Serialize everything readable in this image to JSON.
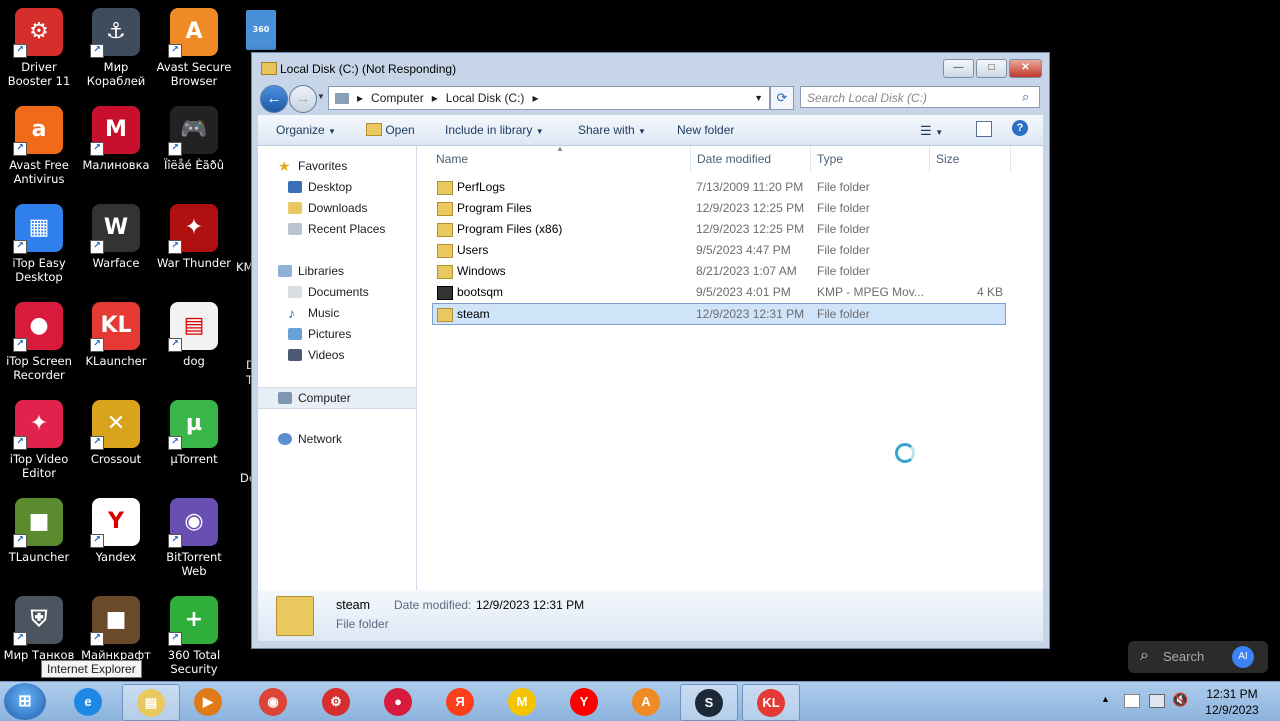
{
  "desktop": {
    "icons": [
      {
        "label": "Driver Booster 11",
        "color": "#d62d2d",
        "glyph": "⚙"
      },
      {
        "label": "Мир Кораблей",
        "color": "#3f4c5c",
        "glyph": "⚓"
      },
      {
        "label": "Avast Secure Browser",
        "color": "#f08a24",
        "glyph": "A"
      },
      {
        "label": "Avast Free Antivirus",
        "color": "#f06a1a",
        "glyph": "a"
      },
      {
        "label": "Малиновка",
        "color": "#c8102e",
        "glyph": "M"
      },
      {
        "label": "Ïîëåé Èãðû",
        "color": "#222222",
        "glyph": "🎮"
      },
      {
        "label": "iTop Easy Desktop",
        "color": "#2f80ed",
        "glyph": "▦"
      },
      {
        "label": "Warface",
        "color": "#333333",
        "glyph": "W"
      },
      {
        "label": "War Thunder",
        "color": "#b01010",
        "glyph": "✦"
      },
      {
        "label": "iTop Screen Recorder",
        "color": "#d81b3c",
        "glyph": "●"
      },
      {
        "label": "KLauncher",
        "color": "#e53935",
        "glyph": "KL"
      },
      {
        "label": "dog",
        "color": "#f2f2f2",
        "glyph": "▤"
      },
      {
        "label": "iTop Video Editor",
        "color": "#e0224d",
        "glyph": "✦"
      },
      {
        "label": "Crossout",
        "color": "#d9a31c",
        "glyph": "✕"
      },
      {
        "label": "µTorrent",
        "color": "#39b54a",
        "glyph": "µ"
      },
      {
        "label": "TLauncher",
        "color": "#5a8c2f",
        "glyph": "■"
      },
      {
        "label": "Yandex",
        "color": "#ffffff",
        "glyph": "Y"
      },
      {
        "label": "BitTorrent Web",
        "color": "#6a4fb3",
        "glyph": "◉"
      },
      {
        "label": "Мир Танков",
        "color": "#4a5560",
        "glyph": "⛨"
      },
      {
        "label": "Майнкрафт",
        "color": "#6b4a2a",
        "glyph": "■"
      },
      {
        "label": "360 Total Security",
        "color": "#2fae3b",
        "glyph": "+"
      }
    ],
    "partial_labels": [
      "KM",
      "D",
      "T",
      "De"
    ],
    "tooltip": "Internet Explorer"
  },
  "window": {
    "title": "Local Disk (C:) (Not Responding)",
    "minimize": "—",
    "maximize": "□",
    "close": "✕",
    "address": {
      "segments": [
        "Computer",
        "Local Disk (C:)"
      ],
      "separator": "▸"
    },
    "search_placeholder": "Search Local Disk (C:)",
    "toolbar": {
      "organize": "Organize",
      "open": "Open",
      "include_in_library": "Include in library",
      "share_with": "Share with",
      "new_folder": "New folder"
    },
    "nav": {
      "favorites": "Favorites",
      "desktop": "Desktop",
      "downloads": "Downloads",
      "recent_places": "Recent Places",
      "libraries": "Libraries",
      "documents": "Documents",
      "music": "Music",
      "pictures": "Pictures",
      "videos": "Videos",
      "computer": "Computer",
      "network": "Network"
    },
    "columns": {
      "name": "Name",
      "date_modified": "Date modified",
      "type": "Type",
      "size": "Size"
    },
    "files": [
      {
        "name": "PerfLogs",
        "date": "7/13/2009 11:20 PM",
        "type": "File folder",
        "size": "",
        "selected": false
      },
      {
        "name": "Program Files",
        "date": "12/9/2023 12:25 PM",
        "type": "File folder",
        "size": "",
        "selected": false
      },
      {
        "name": "Program Files (x86)",
        "date": "12/9/2023 12:25 PM",
        "type": "File folder",
        "size": "",
        "selected": false
      },
      {
        "name": "Users",
        "date": "9/5/2023 4:47 PM",
        "type": "File folder",
        "size": "",
        "selected": false
      },
      {
        "name": "Windows",
        "date": "8/21/2023 1:07 AM",
        "type": "File folder",
        "size": "",
        "selected": false
      },
      {
        "name": "bootsqm",
        "date": "9/5/2023 4:01 PM",
        "type": "KMP - MPEG Mov...",
        "size": "4 KB",
        "selected": false
      },
      {
        "name": "steam",
        "date": "12/9/2023 12:31 PM",
        "type": "File folder",
        "size": "",
        "selected": true
      }
    ],
    "details": {
      "name": "steam",
      "date_label": "Date modified:",
      "date_value": "12/9/2023 12:31 PM",
      "type": "File folder"
    }
  },
  "taskbar": {
    "apps": [
      {
        "name": "internet-explorer",
        "color": "#1e88e5",
        "glyph": "e"
      },
      {
        "name": "explorer",
        "color": "#e9c85f",
        "glyph": "▤"
      },
      {
        "name": "media-player",
        "color": "#e07b1a",
        "glyph": "▶"
      },
      {
        "name": "chrome",
        "color": "#db4437",
        "glyph": "◉"
      },
      {
        "name": "driver-booster",
        "color": "#d62d2d",
        "glyph": "⚙"
      },
      {
        "name": "itop-screen-recorder",
        "color": "#d81b3c",
        "glyph": "●"
      },
      {
        "name": "yandex-browser",
        "color": "#fc3f1d",
        "glyph": "Я"
      },
      {
        "name": "malinovka",
        "color": "#f5c400",
        "glyph": "M"
      },
      {
        "name": "yandex",
        "color": "#ff0000",
        "glyph": "Y"
      },
      {
        "name": "avast-browser",
        "color": "#f08a24",
        "glyph": "A"
      },
      {
        "name": "steam",
        "color": "#1b2838",
        "glyph": "S"
      },
      {
        "name": "klauncher",
        "color": "#e53935",
        "glyph": "KL"
      }
    ],
    "time": "12:31 PM",
    "date": "12/9/2023",
    "search_label": "Search",
    "ai_label": "AI"
  }
}
